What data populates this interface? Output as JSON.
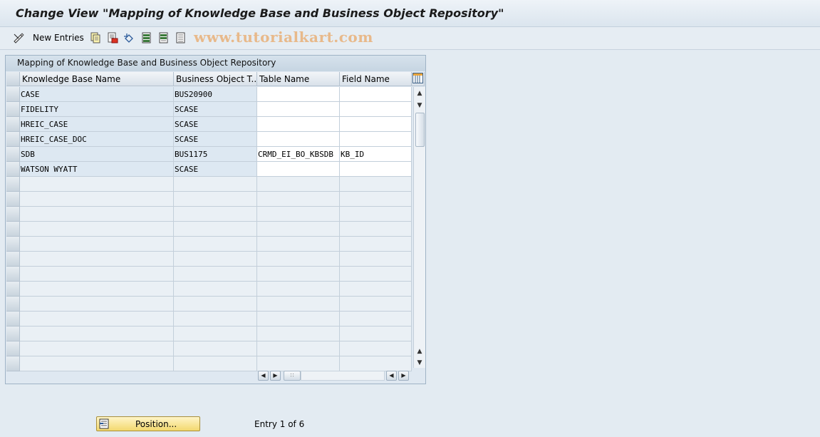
{
  "window": {
    "title": "Change View \"Mapping of Knowledge Base and Business Object Repository\""
  },
  "toolbar": {
    "new_entries_label": "New Entries",
    "icons": [
      "change-display-icon",
      "copy-icon",
      "delete-icon",
      "undo-icon",
      "select-all-icon",
      "select-block-icon",
      "deselect-all-icon"
    ]
  },
  "watermark": "www.tutorialkart.com",
  "table": {
    "title": "Mapping of Knowledge Base and Business Object Repository",
    "columns": [
      "Knowledge Base Name",
      "Business Object T...",
      "Table Name",
      "Field Name"
    ],
    "rows": [
      {
        "kb": "CASE",
        "bo": "BUS20900",
        "table": "",
        "field": ""
      },
      {
        "kb": "FIDELITY",
        "bo": "SCASE",
        "table": "",
        "field": ""
      },
      {
        "kb": "HREIC_CASE",
        "bo": "SCASE",
        "table": "",
        "field": ""
      },
      {
        "kb": "HREIC_CASE_DOC",
        "bo": "SCASE",
        "table": "",
        "field": ""
      },
      {
        "kb": "SDB",
        "bo": "BUS1175",
        "table": "CRMD_EI_BO_KBSDB",
        "field": "KB_ID"
      },
      {
        "kb": "WATSON WYATT",
        "bo": "SCASE",
        "table": "",
        "field": ""
      }
    ]
  },
  "footer": {
    "position_label": "Position...",
    "entry_info": "Entry 1 of 6"
  },
  "colors": {
    "background": "#e3ebf2",
    "key_cell": "#dde8f2",
    "edit_cell": "#ffffff",
    "position_button": "#f3d86e"
  }
}
